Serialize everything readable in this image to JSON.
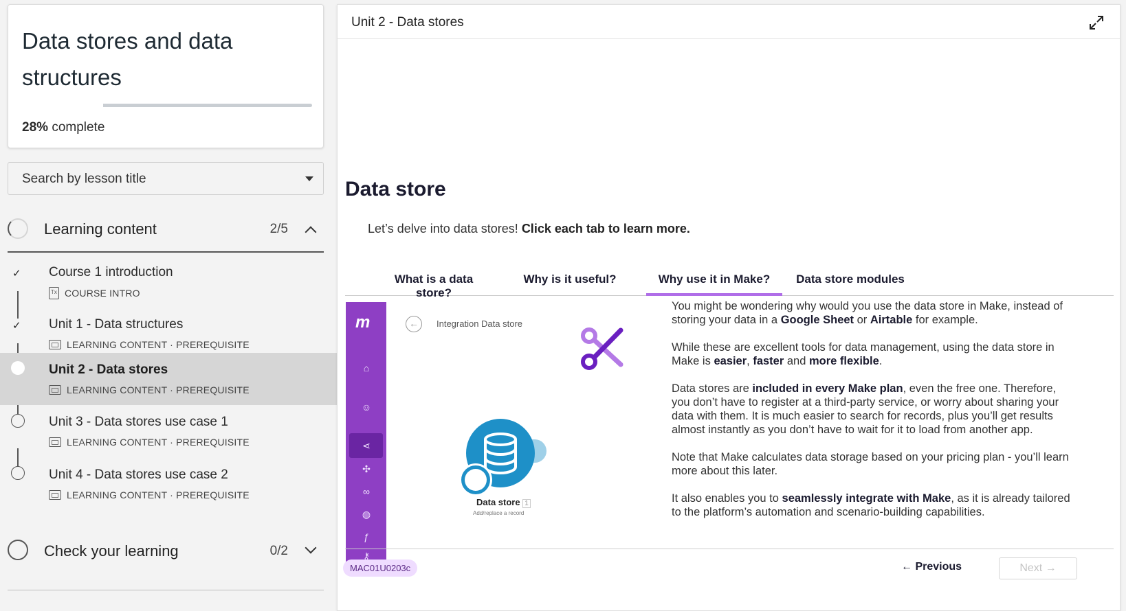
{
  "course": {
    "title": "Data stores and data structures",
    "progress_value": "28%",
    "progress_label": "complete",
    "progress_fraction": 0.28
  },
  "search": {
    "placeholder": "Search by lesson title"
  },
  "sections": {
    "learning": {
      "title": "Learning content",
      "count": "2/5"
    },
    "check": {
      "title": "Check your learning",
      "count": "0/2"
    }
  },
  "lessons": [
    {
      "title": "Course 1 introduction",
      "meta": "COURSE INTRO"
    },
    {
      "title": "Unit 1 - Data structures",
      "meta": "LEARNING CONTENT · PREREQUISITE"
    },
    {
      "title": "Unit 2 - Data stores",
      "meta": "LEARNING CONTENT · PREREQUISITE"
    },
    {
      "title": "Unit 3 - Data stores use case 1",
      "meta": "LEARNING CONTENT · PREREQUISITE"
    },
    {
      "title": "Unit 4 - Data stores use case 2",
      "meta": "LEARNING CONTENT · PREREQUISITE"
    }
  ],
  "main": {
    "title": "Unit 2 - Data stores",
    "content_title": "Data store",
    "intro_plain": "Let’s delve into data stores! ",
    "intro_bold": "Click each tab to learn more.",
    "tabs": [
      "What is a data store?",
      "Why is it useful?",
      "Why use it in Make?",
      "Data store modules"
    ],
    "active_tab": "Why use it in Make?",
    "mock": {
      "breadcrumb": "Integration Data store",
      "node_label": "Data store",
      "node_sub": "Add/replace a record",
      "node_badge": "1"
    },
    "explain": {
      "p1_a": "You might be wondering why would you use the data store in Make, instead of storing your data in a ",
      "p1_b": "Google Sheet",
      "p1_c": " or ",
      "p1_d": "Airtable",
      "p1_e": " for example.",
      "p2_a": "While these are excellent tools for data management, using the data store in Make is ",
      "p2_b": "easier",
      "p2_c": ", ",
      "p2_d": "faster",
      "p2_e": " and ",
      "p2_f": "more flexible",
      "p2_g": ".",
      "p3_a": "Data stores are ",
      "p3_b": "included in every Make plan",
      "p3_c": ", even the free one. Therefore, you don’t have to register at a third-party service, or worry about sharing your data with them. It is much easier to search for records, plus you’ll get results almost instantly as you don’t have to wait for it to load from another app.",
      "p4": "Note that Make calculates data storage based on your pricing plan - you’ll learn more about this later.",
      "p5_a": "It also enables you to ",
      "p5_b": "seamlessly integrate with Make",
      "p5_c": ", as it is already tailored to the platform’s automation and scenario-building capabilities."
    },
    "lesson_code": "MAC01U0203c",
    "prev_label": "← Previous",
    "next_label": "Next →"
  },
  "colors": {
    "accent": "#b06ee8",
    "rail": "#8e3fc4",
    "data_store_blue": "#1e90c8"
  }
}
